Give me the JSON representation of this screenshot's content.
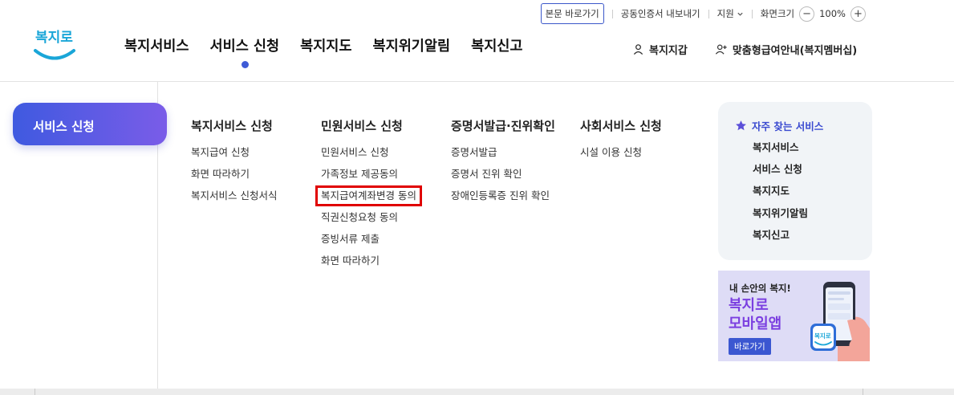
{
  "utility": {
    "skip_link": "본문 바로가기",
    "cert_export": "공동인증서 내보내기",
    "support": "지원",
    "screen_size": "화면크기",
    "zoom_minus": "−",
    "zoom_value": "100%",
    "zoom_plus": "+"
  },
  "logo": {
    "text": "복지로"
  },
  "gnb": [
    {
      "label": "복지서비스"
    },
    {
      "label": "서비스 신청"
    },
    {
      "label": "복지지도"
    },
    {
      "label": "복지위기알림"
    },
    {
      "label": "복지신고"
    }
  ],
  "header_right": {
    "wallet": "복지지갑",
    "membership": "맞춤형급여안내(복지멤버십)"
  },
  "side": {
    "active_label": "서비스 신청"
  },
  "menu": {
    "columns": [
      {
        "title": "복지서비스 신청",
        "items": [
          "복지급여 신청",
          "화면 따라하기",
          "복지서비스 신청서식"
        ]
      },
      {
        "title": "민원서비스 신청",
        "items": [
          "민원서비스 신청",
          "가족정보 제공동의",
          "복지급여계좌변경 동의",
          "직권신청요청 동의",
          "증빙서류 제출",
          "화면 따라하기"
        ]
      },
      {
        "title": "증명서발급·진위확인",
        "items": [
          "증명서발급",
          "증명서 진위 확인",
          "장애인등록증 진위 확인"
        ]
      },
      {
        "title": "사회서비스 신청",
        "items": [
          "시설 이용 신청"
        ]
      }
    ]
  },
  "favorites": {
    "title": "자주 찾는 서비스",
    "items": [
      "복지서비스",
      "서비스 신청",
      "복지지도",
      "복지위기알림",
      "복지신고"
    ]
  },
  "banner": {
    "line1": "내 손안의 복지!",
    "line2": "복지로",
    "line3": "모바일앱",
    "button": "바로가기",
    "app_icon_text": "복지로"
  },
  "colors": {
    "accent": "#3e5bd6",
    "highlight": "#e00000",
    "purple": "#7b3fe0"
  }
}
